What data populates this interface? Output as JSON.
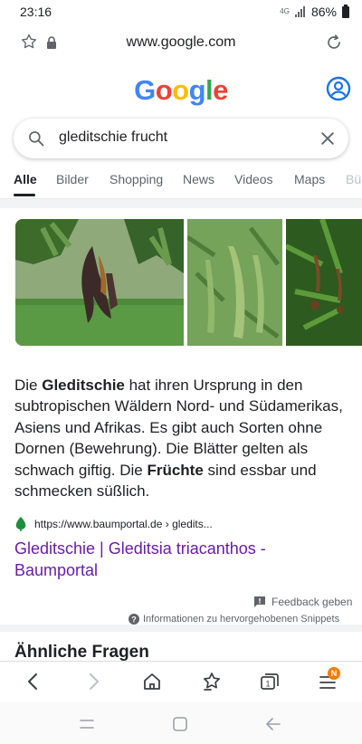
{
  "status": {
    "time": "23:16",
    "network": "4G",
    "battery": "86%"
  },
  "urlbar": {
    "url": "www.google.com"
  },
  "logo": {
    "letters": [
      "G",
      "o",
      "o",
      "g",
      "l",
      "e"
    ]
  },
  "search": {
    "query": "gleditschie frucht"
  },
  "tabs": [
    "Alle",
    "Bilder",
    "Shopping",
    "News",
    "Videos",
    "Maps",
    "Bü"
  ],
  "snippet": {
    "t1": "Die ",
    "b1": "Gleditschie",
    "t2": " hat ihren Ursprung in den subtropischen Wäldern Nord- und Südamerikas, Asiens und Afrikas. Es gibt auch Sorten ohne Dornen (Bewehrung). Die Blätter gelten als schwach giftig. Die ",
    "b2": "Früchte",
    "t3": " sind essbar und schmecken süßlich."
  },
  "result": {
    "source": "https://www.baumportal.de › gledits...",
    "title": "Gleditschie | Gleditsia triacanthos - Baumportal"
  },
  "feedback": {
    "label": "Feedback geben"
  },
  "featured_info": {
    "label": "Informationen zu hervorgehobenen Snippets"
  },
  "related": {
    "title": "Ähnliche Fragen"
  },
  "toolbar": {
    "tabs_count": "1",
    "menu_badge": "N"
  },
  "colors": {
    "visited_link": "#681da8",
    "google_blue": "#4285f4",
    "badge": "#f57c00"
  }
}
